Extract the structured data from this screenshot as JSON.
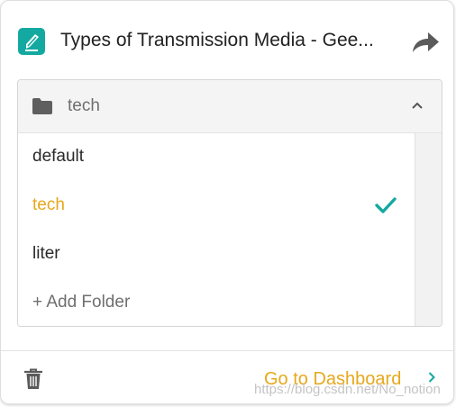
{
  "header": {
    "title": "Types of Transmission Media - Gee...",
    "logo_icon": "feather-pen-icon",
    "share_icon": "share-arrow-icon"
  },
  "folder_dropdown": {
    "selected": "tech",
    "expanded": true,
    "options": [
      {
        "label": "default",
        "selected": false
      },
      {
        "label": "tech",
        "selected": true
      },
      {
        "label": "liter",
        "selected": false
      }
    ],
    "add_folder_label": "+ Add Folder"
  },
  "footer": {
    "delete_icon": "trash-icon",
    "dashboard_label": "Go to Dashboard"
  },
  "watermark": "https://blog.csdn.net/No_notion",
  "colors": {
    "accent": "#e6a81c",
    "brand": "#14a9a0",
    "check": "#14a9a0"
  }
}
